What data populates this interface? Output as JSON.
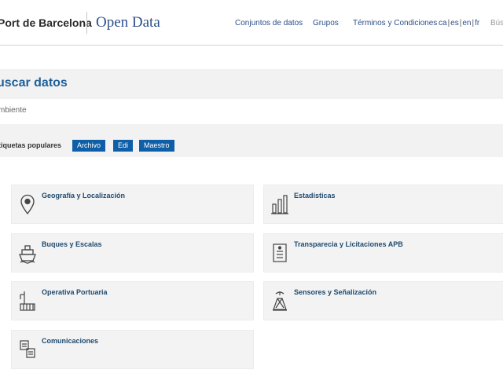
{
  "header": {
    "logo_port": "Port de Barcelona",
    "logo_open_data": "Open Data",
    "nav": [
      "Conjuntos de datos",
      "Grupos",
      "Términos y Condiciones"
    ],
    "languages": [
      "ca",
      "es",
      "en",
      "fr"
    ],
    "search_partial": "Bús"
  },
  "main": {
    "title": "uscar datos",
    "subtext": "mbiente",
    "tags_label": "tiquetas populares",
    "tags": [
      "Archivo",
      "Edi",
      "Maestro"
    ]
  },
  "categories": [
    {
      "label": "Geografía y Localización",
      "icon": "location-pin-icon"
    },
    {
      "label": "Estadísticas",
      "icon": "bar-chart-icon"
    },
    {
      "label": "Buques y Escalas",
      "icon": "ship-icon"
    },
    {
      "label": "Transparecia y Licitaciones APB",
      "icon": "document-icon"
    },
    {
      "label": "Operativa Portuaria",
      "icon": "port-crane-icon"
    },
    {
      "label": "Sensores y Señalización",
      "icon": "beacon-tower-icon"
    },
    {
      "label": "Comunicaciones",
      "icon": "documents-icon"
    }
  ],
  "colors": {
    "accent": "#1f5f9a",
    "tag_bg": "#0f5fa8",
    "link": "#2b4f8a",
    "band": "#f2f2f2"
  }
}
